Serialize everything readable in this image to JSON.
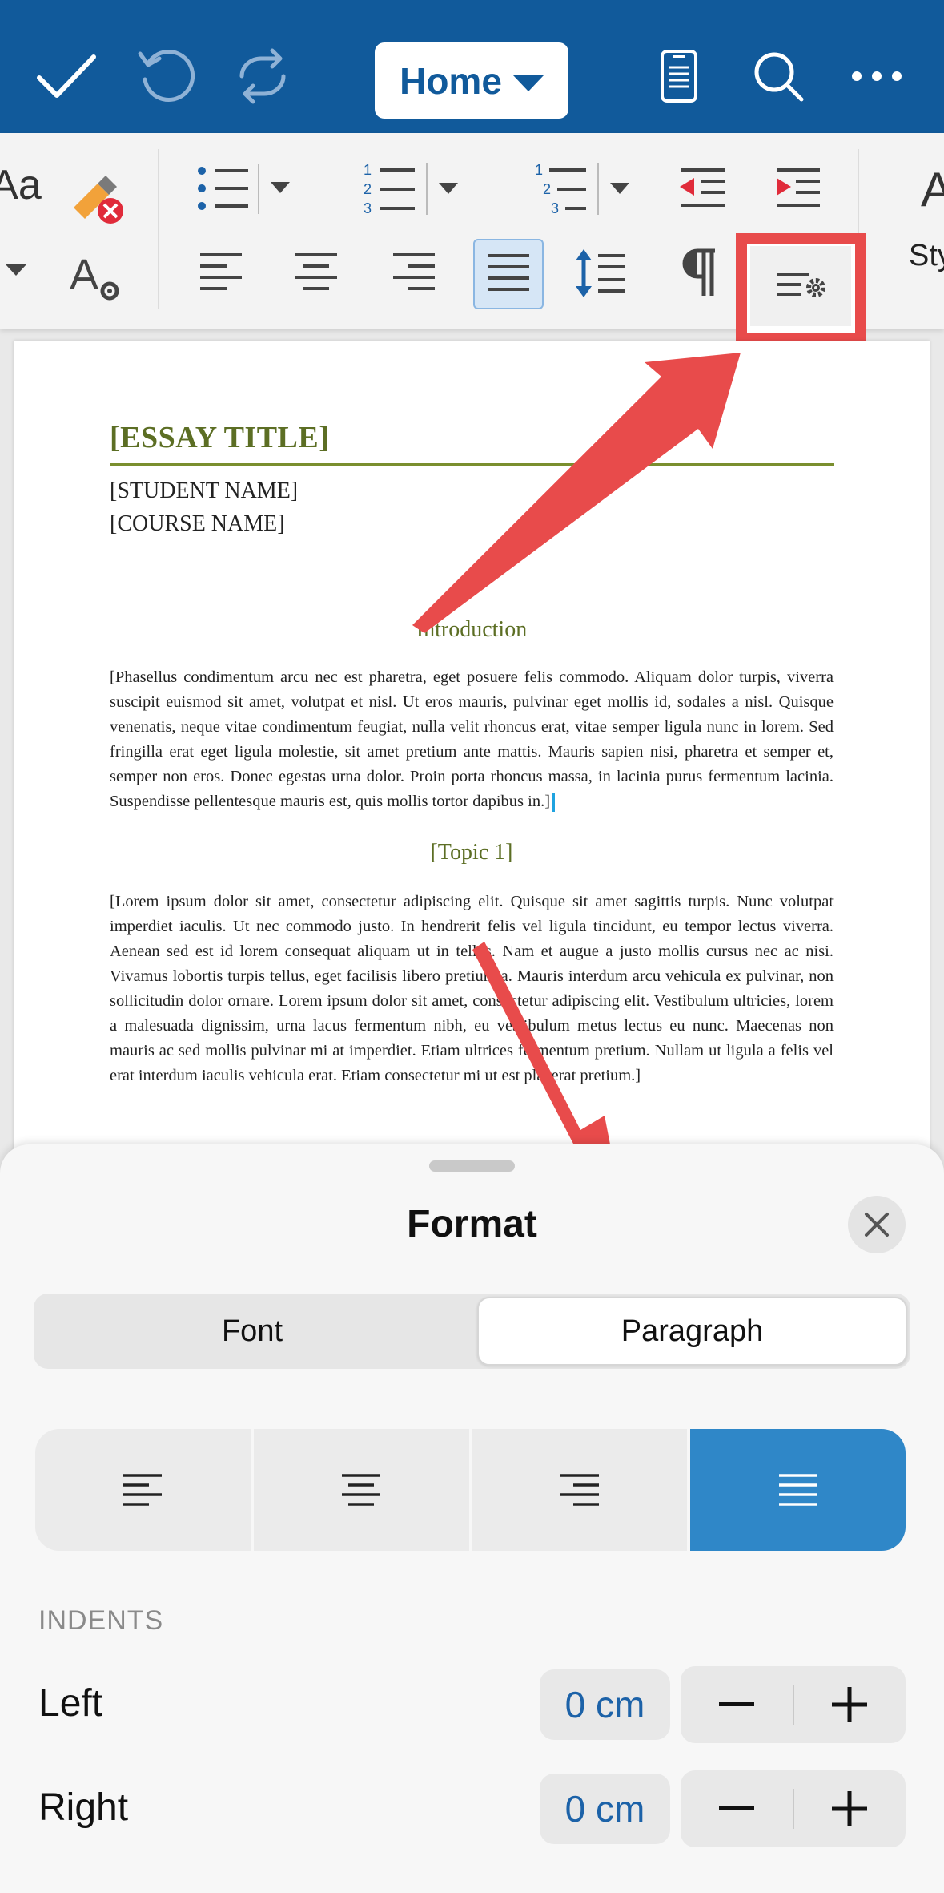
{
  "toolbar": {
    "tab_label": "Home"
  },
  "ribbon": {
    "styles_label": "Sty",
    "active_alignment": "justify"
  },
  "document": {
    "title": "[ESSAY TITLE]",
    "student": "[STUDENT NAME]",
    "course": "[COURSE NAME]",
    "intro_heading": "Introduction",
    "intro_text": "[Phasellus condimentum arcu nec est pharetra, eget posuere felis commodo. Aliquam dolor turpis, viverra suscipit euismod sit amet, volutpat et nisl. Ut eros mauris, pulvinar eget mollis id, sodales a nisl. Quisque venenatis, neque vitae condimentum feugiat, nulla velit rhoncus erat, vitae semper ligula nunc in lorem. Sed fringilla erat eget ligula molestie, sit amet pretium ante mattis. Mauris sapien nisi, pharetra et semper et, semper non eros. Donec egestas urna dolor. Proin porta rhoncus massa, in lacinia purus fermentum lacinia. Suspendisse pellentesque mauris est, quis mollis tortor dapibus in.]",
    "topic_heading": "[Topic 1]",
    "topic_text": "[Lorem ipsum dolor sit amet, consectetur adipiscing elit. Quisque sit amet sagittis turpis. Nunc volutpat imperdiet iaculis. Ut nec commodo justo. In hendrerit felis vel ligula tincidunt, eu tempor lectus viverra. Aenean sed est id lorem consequat aliquam ut in tellus. Nam et augue a justo mollis cursus nec ac nisi. Vivamus lobortis turpis tellus, eget facilisis libero pretium a. Mauris interdum arcu vehicula ex pulvinar, non sollicitudin dolor ornare. Lorem ipsum dolor sit amet, consectetur adipiscing elit. Vestibulum ultricies, lorem a malesuada dignissim, urna lacus fermentum nibh, eu vestibulum metus lectus eu nunc. Maecenas non mauris ac sed mollis pulvinar mi at imperdiet. Etiam ultrices fermentum pretium. Nullam ut ligula a felis vel erat interdum iaculis vehicula erat. Etiam consectetur mi ut est placerat pretium.]"
  },
  "format_sheet": {
    "title": "Format",
    "tabs": [
      {
        "label": "Font",
        "selected": false
      },
      {
        "label": "Paragraph",
        "selected": true
      }
    ],
    "alignment_options": [
      "left",
      "center",
      "right",
      "justify"
    ],
    "selected_alignment": "justify",
    "indents_label": "INDENTS",
    "indents": [
      {
        "label": "Left",
        "value": "0 cm"
      },
      {
        "label": "Right",
        "value": "0 cm"
      }
    ]
  },
  "colors": {
    "toolbar_blue": "#115a9b",
    "accent_blue": "#2f87c8",
    "annotation_red": "#e84b4b",
    "heading_olive": "#5c6e24"
  }
}
